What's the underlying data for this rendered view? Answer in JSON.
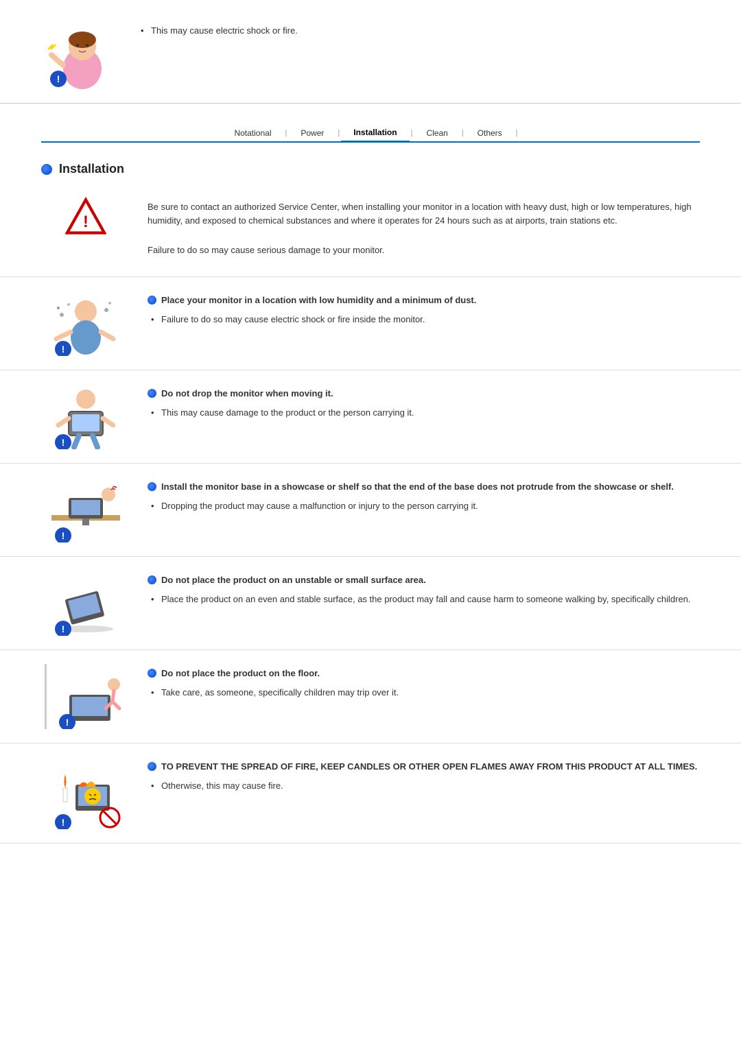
{
  "top": {
    "bullet": "This may cause electric shock or fire."
  },
  "nav": {
    "tabs": [
      {
        "label": "Notational",
        "active": false
      },
      {
        "label": "Power",
        "active": false
      },
      {
        "label": "Installation",
        "active": true
      },
      {
        "label": "Clean",
        "active": false
      },
      {
        "label": "Others",
        "active": false
      }
    ]
  },
  "section": {
    "title": "Installation"
  },
  "blocks": [
    {
      "id": "block-0",
      "hasTriangle": true,
      "texts": [
        "Be sure to contact an authorized Service Center, when installing your monitor in a location with heavy dust, high or low temperatures, high humidity, and exposed to chemical substances and where it operates for 24 hours such as at airports, train stations etc.",
        "Failure to do so may cause serious damage to your monitor."
      ],
      "bullets": []
    },
    {
      "id": "block-1",
      "warnTitle": "Place your monitor in a location with low humidity and a minimum of dust.",
      "bullets": [
        "Failure to do so may cause electric shock or fire inside the monitor."
      ]
    },
    {
      "id": "block-2",
      "warnTitle": "Do not drop the monitor when moving it.",
      "bullets": [
        "This may cause damage to the product or the person carrying it."
      ]
    },
    {
      "id": "block-3",
      "warnTitle": "Install the monitor base in a showcase or shelf so that the end of the base does not protrude from the showcase or shelf.",
      "bullets": [
        "Dropping the product may cause a malfunction or injury to the person carrying it."
      ]
    },
    {
      "id": "block-4",
      "warnTitle": "Do not place the product on an unstable or small surface area.",
      "bullets": [
        "Place the product on an even and stable surface, as the product may fall and cause harm to someone walking by, specifically children."
      ]
    },
    {
      "id": "block-5",
      "warnTitle": "Do not place the product on the floor.",
      "bullets": [
        "Take care, as someone, specifically children may trip over it."
      ]
    },
    {
      "id": "block-6",
      "warnTitle": "TO PREVENT THE SPREAD OF FIRE, KEEP CANDLES OR OTHER OPEN FLAMES AWAY FROM THIS PRODUCT AT ALL TIMES.",
      "bullets": [
        "Otherwise, this may cause fire."
      ]
    }
  ]
}
